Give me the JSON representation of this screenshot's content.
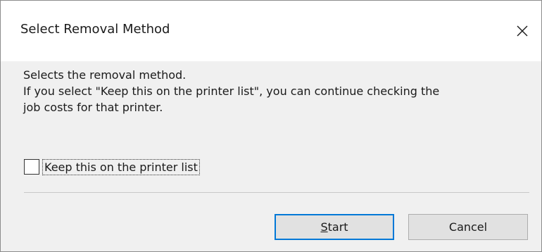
{
  "window": {
    "title": "Select Removal Method"
  },
  "message": {
    "line1": "Selects the removal method.",
    "line2": "If you select \"Keep this on the printer list\", you can continue checking the",
    "line3": "job costs for that printer."
  },
  "checkbox": {
    "label": "Keep this on the printer list",
    "checked": false
  },
  "buttons": {
    "start_mnemonic": "S",
    "start_rest": "tart",
    "cancel_label": "Cancel"
  },
  "colors": {
    "focus_border": "#0078d7",
    "client_bg": "#f0f0f0",
    "button_bg": "#e1e1e1"
  },
  "icons": {
    "close": "close-icon"
  }
}
